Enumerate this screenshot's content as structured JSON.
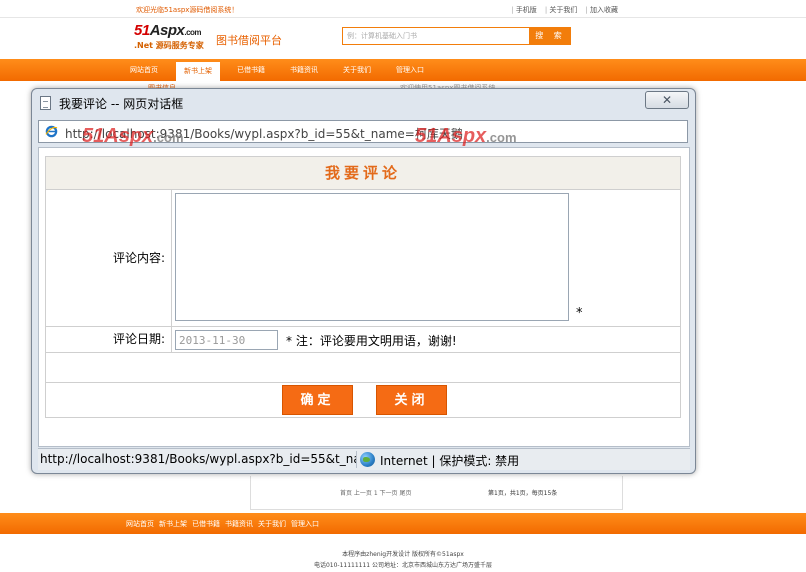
{
  "site": {
    "welcome": "欢迎光临51aspx源码借阅系统！",
    "top_links": [
      "手机版",
      "关于我们",
      "加入收藏"
    ],
    "logo_text": "51Aspx",
    "logo_num": "51",
    "logo_rest": "Aspx",
    "logo_com": ".com",
    "logo_sub": ".Net 源码服务专家",
    "platform_name": "图书借阅平台",
    "search_placeholder": "例：计算机基础入门书",
    "search_button": "搜 索",
    "nav": [
      "网站首页",
      "新书上架",
      "已借书籍",
      "书籍资讯",
      "关于我们",
      "管理入口"
    ],
    "nav_active_index": 1,
    "breadcrumb": "图书信息",
    "notice": "欢迎使用51aspx图书借阅系统",
    "pager_left": "首页 上一页 1 下一页 尾页",
    "pager_right": "第1页，共1页，每页15条",
    "footer_nav": [
      "网站首页",
      "新书上架",
      "已借书籍",
      "书籍资讯",
      "关于我们",
      "管理入口"
    ],
    "copyright": "本程序由zhenig开发设计 版权所有©51aspx",
    "address": "电话010-11111111 公司地址：北京市西城山东方达广场万盛千层"
  },
  "dialog": {
    "title": "我要评论 -- 网页对话框",
    "close_glyph": "✕",
    "address_url": "http://localhost:9381/Books/wypl.aspx?b_id=55&t_name=柯库天鹅",
    "watermark_main": "51Aspx",
    "watermark_com": ".com",
    "form": {
      "header": "我要评论",
      "comment_label": "评论内容:",
      "comment_value": "",
      "required_mark": "*",
      "date_label": "评论日期:",
      "date_value": "2013-11-30",
      "date_note": "* 注：评论要用文明用语，谢谢!",
      "ok_button": "确定",
      "close_button": "关闭"
    },
    "status": {
      "url": "http://localhost:9381/Books/wypl.aspx?b_id=55&t_name=",
      "zone": "Internet | 保护模式: 禁用"
    }
  },
  "colors": {
    "accent_orange": "#f56b14",
    "nav_orange": "#f27d0b",
    "watermark_red": "#dc1e1e"
  }
}
